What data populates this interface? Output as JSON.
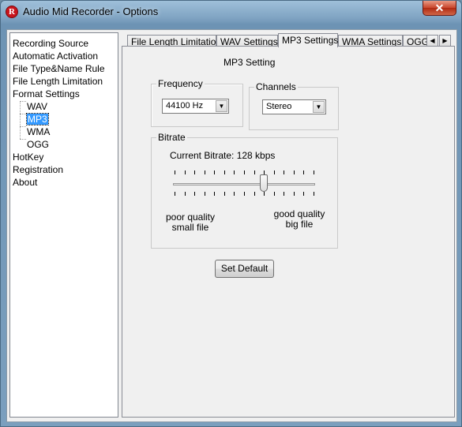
{
  "window": {
    "title": "Audio Mid Recorder - Options",
    "icon": "app-logo-icon",
    "icon_letter": "R",
    "close_glyph": "✕"
  },
  "tree": {
    "items": [
      {
        "label": "Recording Source"
      },
      {
        "label": "Automatic Activation"
      },
      {
        "label": "File Type&Name Rule"
      },
      {
        "label": "File Length Limitation"
      },
      {
        "label": "Format Settings"
      },
      {
        "label": "WAV"
      },
      {
        "label": "MP3"
      },
      {
        "label": "WMA"
      },
      {
        "label": "OGG"
      },
      {
        "label": "HotKey"
      },
      {
        "label": "Registration"
      },
      {
        "label": "About"
      }
    ],
    "selected": "MP3"
  },
  "tabs": {
    "items": [
      {
        "label": "File Length Limitation"
      },
      {
        "label": "WAV Settings"
      },
      {
        "label": "MP3 Settings"
      },
      {
        "label": "WMA Settings"
      },
      {
        "label": "OGG S"
      }
    ],
    "active": "MP3 Settings",
    "scroll_left": "◀",
    "scroll_right": "▶"
  },
  "mp3": {
    "heading": "MP3 Setting",
    "frequency": {
      "label": "Frequency",
      "value": "44100 Hz"
    },
    "channels": {
      "label": "Channels",
      "value": "Stereo"
    },
    "bitrate": {
      "label": "Bitrate",
      "current": "Current Bitrate: 128 kbps",
      "slider_fraction": 0.64,
      "tick_count": 15,
      "low_caption": [
        "poor quality",
        "small file"
      ],
      "high_caption": [
        "good quality",
        "big file"
      ]
    },
    "set_default_label": "Set Default"
  },
  "combo_arrow": "▼"
}
